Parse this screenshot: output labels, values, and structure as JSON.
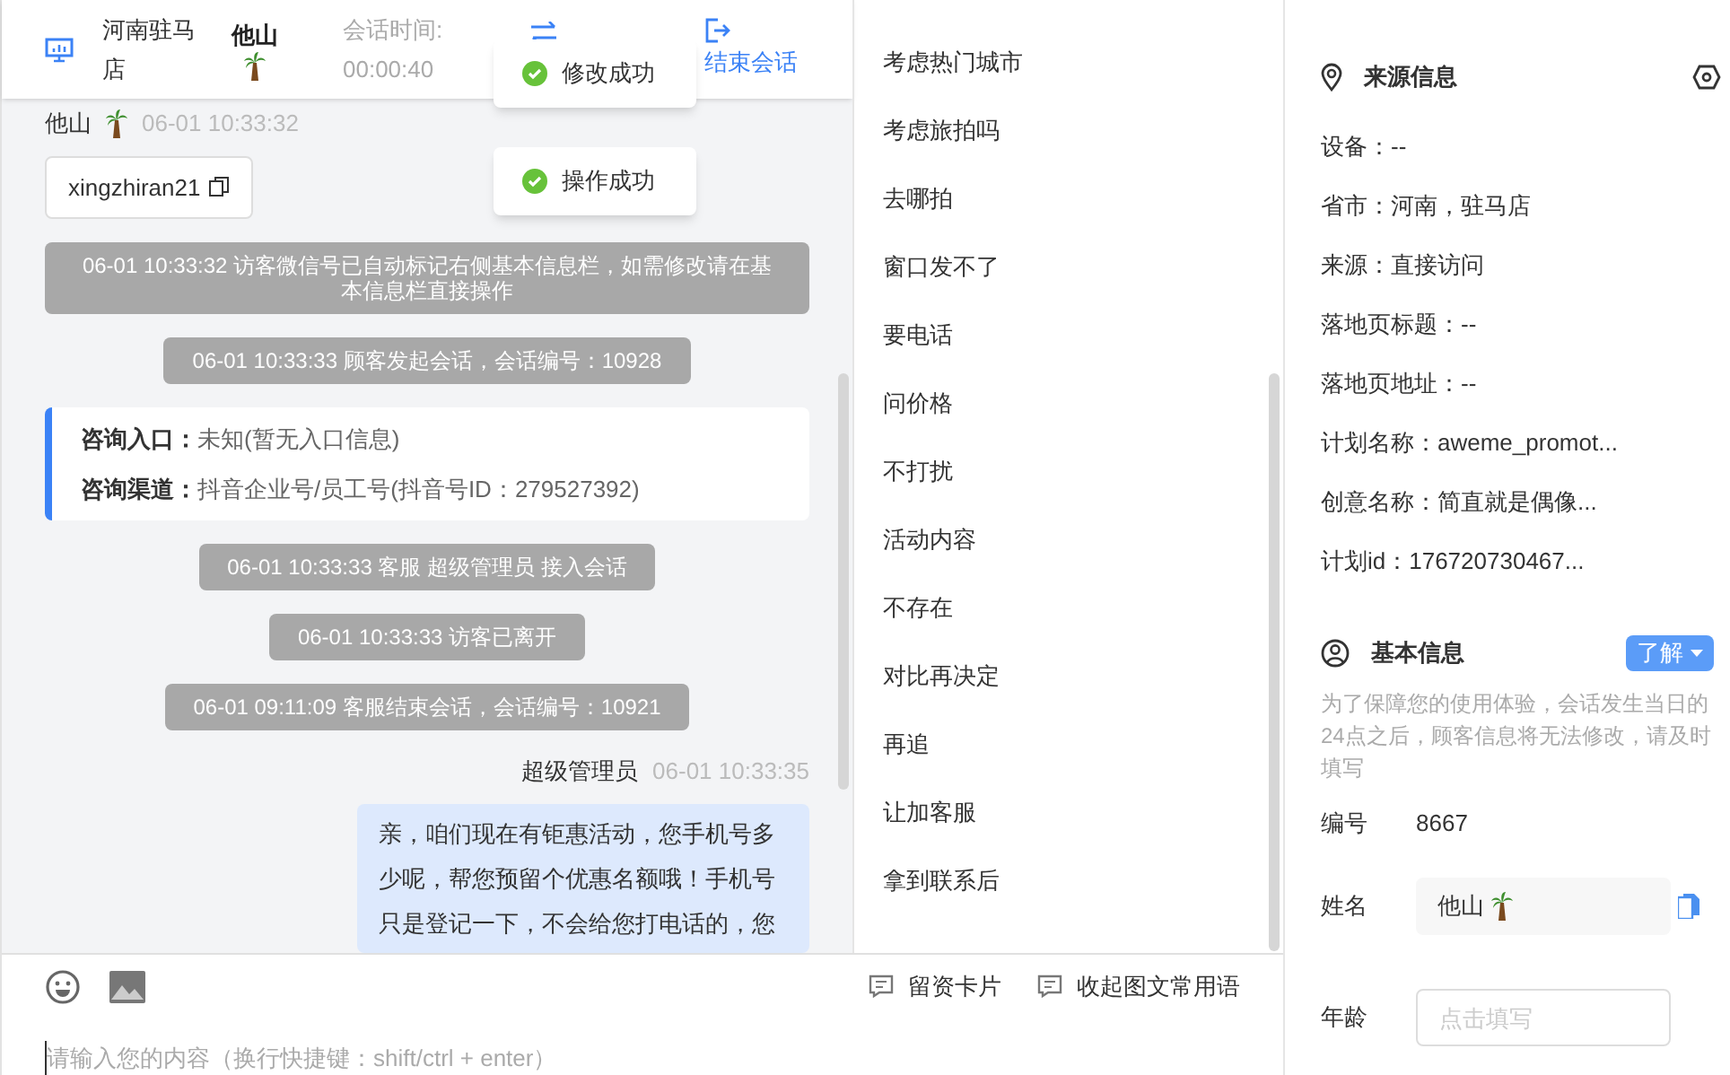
{
  "header": {
    "store": "河南驻马店",
    "visitor": "他山",
    "session_label": "会话时间:",
    "session_time": "00:00:40",
    "end_label": "结束会话"
  },
  "toasts": [
    "修改成功",
    "操作成功"
  ],
  "messages": [
    {
      "kind": "visitor",
      "sender": "他山",
      "time": "06-01 10:33:32",
      "content": "xingzhiran21"
    },
    {
      "kind": "system",
      "text": "06-01 10:33:32 访客微信号已自动标记右侧基本信息栏，如需修改请在基本信息栏直接操作"
    },
    {
      "kind": "system",
      "text": "06-01 10:33:33 顾客发起会话，会话编号：10928"
    },
    {
      "kind": "info",
      "rows": [
        {
          "label": "咨询入口：",
          "value": "未知(暂无入口信息)"
        },
        {
          "label": "咨询渠道：",
          "value": "抖音企业号/员工号(抖音号ID：279527392)"
        }
      ]
    },
    {
      "kind": "system",
      "text": "06-01 10:33:33 客服 超级管理员 接入会话"
    },
    {
      "kind": "system",
      "text": "06-01 10:33:33 访客已离开"
    },
    {
      "kind": "system",
      "text": "06-01 09:11:09 客服结束会话，会话编号：10921"
    },
    {
      "kind": "agent",
      "sender": "超级管理员",
      "time": "06-01 10:33:35",
      "content": "亲，咱们现在有钜惠活动，您手机号多少呢，帮您预留个优惠名额哦！手机号只是登记一下，不会给您打电话的，您"
    }
  ],
  "quick_replies": [
    "考虑热门城市",
    "考虑旅拍吗",
    "去哪拍",
    "窗口发不了",
    "要电话",
    "问价格",
    "不打扰",
    "活动内容",
    "不存在",
    "对比再决定",
    "再追",
    "让加客服",
    "拿到联系后"
  ],
  "toolbar_buttons": [
    "留资卡片",
    "收起图文常用语"
  ],
  "input": {
    "placeholder": "请输入您的内容（换行快捷键：shift/ctrl + enter）"
  },
  "source_info": {
    "title": "来源信息",
    "rows": [
      "设备：--",
      "省市：河南，驻马店",
      "来源：直接访问",
      "落地页标题：--",
      "落地页地址：--",
      "计划名称：aweme_promot...",
      "创意名称：简直就是偶像...",
      "计划id：176720730467..."
    ]
  },
  "basic_info": {
    "title": "基本信息",
    "learn_button": "了解",
    "note": "为了保障您的使用体验，会话发生当日的24点之后，顾客信息将无法修改，请及时填写",
    "fields": [
      {
        "kind": "text",
        "label": "编号",
        "value": "8667"
      },
      {
        "kind": "name",
        "label": "姓名",
        "value": "他山"
      },
      {
        "kind": "input",
        "label": "年龄",
        "placeholder": "点击填写"
      }
    ]
  }
}
